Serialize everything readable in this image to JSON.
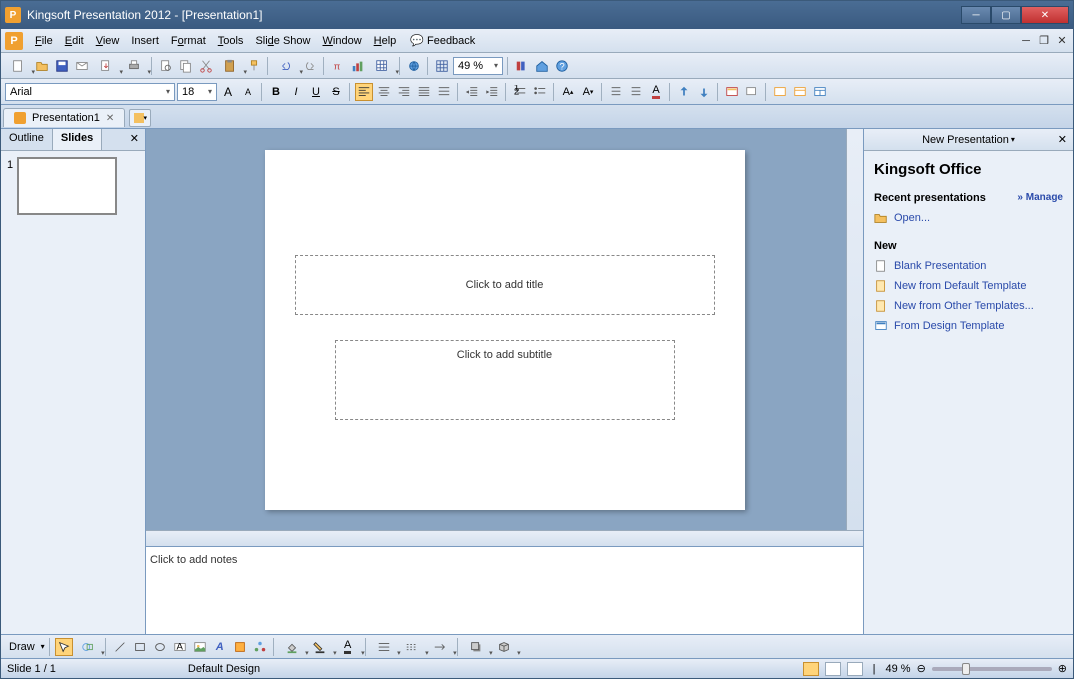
{
  "app": {
    "title": "Kingsoft Presentation 2012 - [Presentation1]"
  },
  "menu": {
    "file": "File",
    "edit": "Edit",
    "view": "View",
    "insert": "Insert",
    "format": "Format",
    "tools": "Tools",
    "slideshow": "Slide Show",
    "window": "Window",
    "help": "Help",
    "feedback": "Feedback"
  },
  "toolbar": {
    "zoom": "49 %"
  },
  "format": {
    "font": "Arial",
    "size": "18"
  },
  "docTab": {
    "name": "Presentation1"
  },
  "leftPane": {
    "outline": "Outline",
    "slides": "Slides",
    "thumbNum": "1"
  },
  "slide": {
    "title_ph": "Click to add title",
    "subtitle_ph": "Click to add subtitle"
  },
  "notes": {
    "placeholder": "Click to add notes"
  },
  "taskPane": {
    "header": "New Presentation",
    "brand": "Kingsoft Office",
    "recentHead": "Recent presentations",
    "manage": "» Manage",
    "open": "Open...",
    "newHead": "New",
    "blank": "Blank Presentation",
    "defaultTpl": "New from Default Template",
    "otherTpl": "New from Other Templates...",
    "designTpl": "From Design Template"
  },
  "draw": {
    "label": "Draw"
  },
  "status": {
    "slide": "Slide 1 / 1",
    "design": "Default Design",
    "zoom": "49 %"
  }
}
